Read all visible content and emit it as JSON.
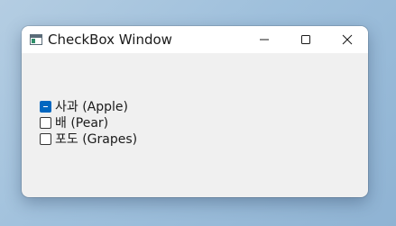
{
  "window": {
    "title": "CheckBox Window",
    "accent_color": "#0067c0",
    "icons": {
      "app": "window-app-icon",
      "minimize": "minimize-icon",
      "maximize": "maximize-icon",
      "close": "close-icon"
    }
  },
  "checkboxes": [
    {
      "label": "사과 (Apple)",
      "state": "indeterminate"
    },
    {
      "label": "배 (Pear)",
      "state": "unchecked"
    },
    {
      "label": "포도 (Grapes)",
      "state": "unchecked"
    }
  ]
}
